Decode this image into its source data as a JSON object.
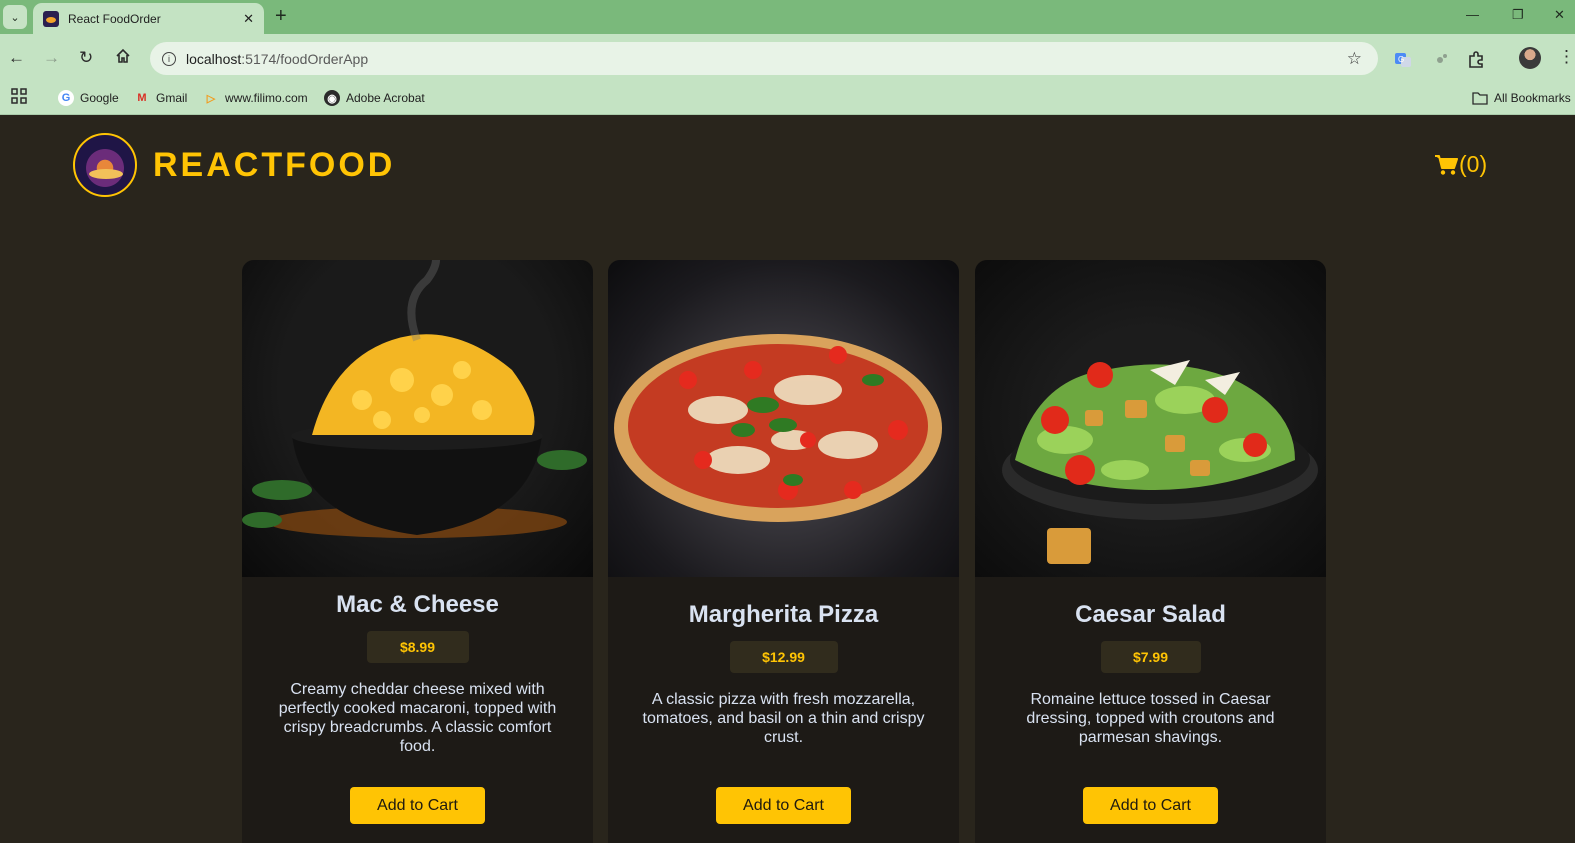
{
  "browser": {
    "tab_title": "React FoodOrder",
    "url_host": "localhost",
    "url_rest": ":5174/foodOrderApp",
    "bookmarks": [
      {
        "label": "Google",
        "icon": "google-icon"
      },
      {
        "label": "Gmail",
        "icon": "gmail-icon"
      },
      {
        "label": "www.filimo.com",
        "icon": "filimo-icon"
      },
      {
        "label": "Adobe Acrobat",
        "icon": "acrobat-icon"
      }
    ],
    "all_bookmarks": "All Bookmarks"
  },
  "header": {
    "title": "REACTFOOD",
    "cart_label": "(0)"
  },
  "meals": [
    {
      "name": "Mac & Cheese",
      "price": "$8.99",
      "description": "Creamy cheddar cheese mixed with perfectly cooked macaroni, topped with crispy breadcrumbs. A classic comfort food.",
      "button": "Add to Cart"
    },
    {
      "name": "Margherita Pizza",
      "price": "$12.99",
      "description": "A classic pizza with fresh mozzarella, tomatoes, and basil on a thin and crispy crust.",
      "button": "Add to Cart"
    },
    {
      "name": "Caesar Salad",
      "price": "$7.99",
      "description": "Romaine lettuce tossed in Caesar dressing, topped with croutons and parmesan shavings.",
      "button": "Add to Cart"
    }
  ],
  "colors": {
    "accent": "#ffc404",
    "page_bg": "#29251c",
    "card_bg": "#1d1a16",
    "chrome_green": "#7ab97b"
  }
}
